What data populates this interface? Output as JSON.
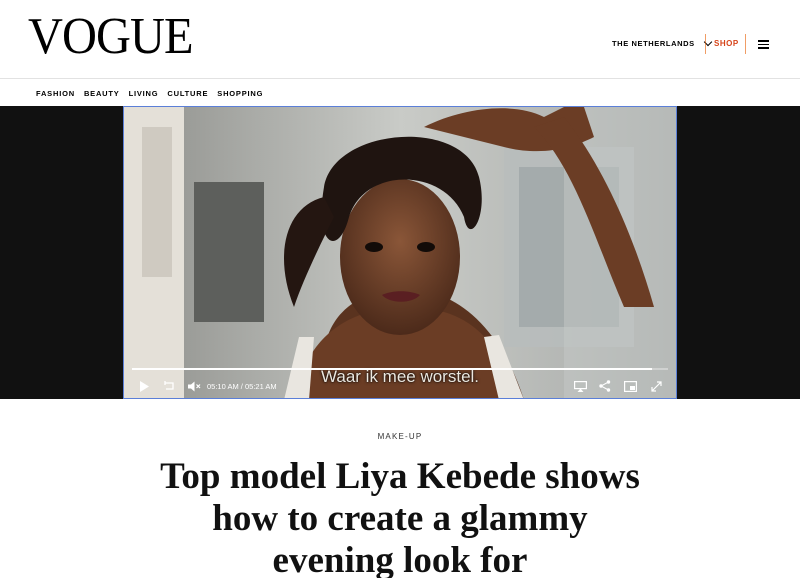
{
  "header": {
    "logo": "VOGUE",
    "region": "THE NETHERLANDS",
    "shop": "SHOP"
  },
  "nav": {
    "items": [
      "FASHION",
      "BEAUTY",
      "LIVING",
      "CULTURE",
      "SHOPPING"
    ]
  },
  "video": {
    "subtitle": "Waar ik mee worstel.",
    "current_time": "05:10 AM",
    "separator": "/",
    "duration": "05:21 AM",
    "progress": 0.97
  },
  "article": {
    "category": "MAKE-UP",
    "headline": "Top model Liya Kebede shows how to create a glammy evening look for"
  },
  "colors": {
    "shop": "#d6441a",
    "player_border": "#5b7fd8"
  }
}
